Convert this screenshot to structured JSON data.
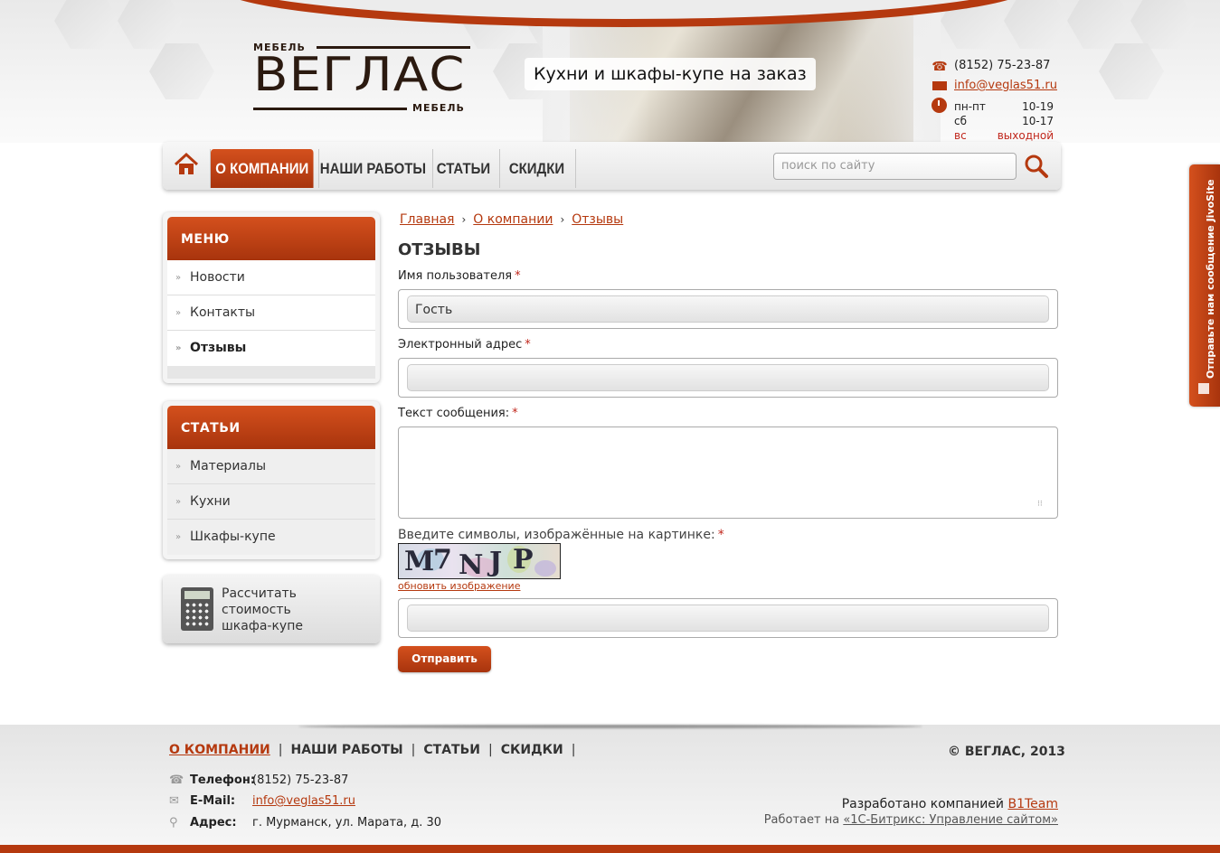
{
  "header": {
    "logo": {
      "top_word": "МЕБЕЛЬ",
      "brand": "ВЕГЛАС",
      "bottom_word": "МЕБЕЛЬ"
    },
    "slogan": "Кухни и шкафы-купе на заказ",
    "phone": "(8152) 75-23-87",
    "email": "info@veglas51.ru",
    "hours": [
      {
        "day": "пн-пт",
        "time": "10-19"
      },
      {
        "day": "сб",
        "time": "10-17"
      },
      {
        "day": "вс",
        "time": "выходной"
      }
    ]
  },
  "nav": {
    "items": [
      "О КОМПАНИИ",
      "НАШИ РАБОТЫ",
      "СТАТЬИ",
      "СКИДКИ"
    ],
    "active": "О КОМПАНИИ",
    "search_placeholder": "поиск по сайту"
  },
  "sidebar": {
    "menu_title": "МЕНЮ",
    "menu_items": [
      "Новости",
      "Контакты",
      "Отзывы"
    ],
    "articles_title": "СТАТЬИ",
    "article_items": [
      "Материалы",
      "Кухни",
      "Шкафы-купе"
    ],
    "calc_line1": "Рассчитать",
    "calc_line2": "стоимость",
    "calc_line3": "шкафа-купе"
  },
  "breadcrumbs": [
    "Главная",
    "О компании",
    "Отзывы"
  ],
  "form": {
    "title": "ОТЗЫВЫ",
    "name_label": "Имя пользователя",
    "name_value": "Гость",
    "email_label": "Электронный адрес",
    "email_value": "",
    "message_label": "Текст сообщения:",
    "message_value": "",
    "captcha_label": "Введите символы, изображённые на картинке:",
    "captcha_chars": [
      "M",
      "7",
      "N",
      "J",
      "P"
    ],
    "captcha_refresh": "обновить изображение",
    "captcha_value": "",
    "required_mark": "*",
    "submit_label": "Отправить"
  },
  "feedback_tab": "Отправьте нам сообщение JivoSite",
  "footer": {
    "nav": [
      "О КОМПАНИИ",
      "НАШИ РАБОТЫ",
      "СТАТЬИ",
      "СКИДКИ"
    ],
    "copyright": "© ВЕГЛАС, 2013",
    "phone_label": "Телефон:",
    "phone": "(8152) 75-23-87",
    "email_label": "E-Mail:",
    "email": "info@veglas51.ru",
    "address_label": "Адрес:",
    "address": "г. Мурманск, ул. Марата, д. 30",
    "developed_prefix": "Разработано компанией",
    "developer": "B1Team",
    "powered_prefix": "Работает на",
    "powered_by": "«1С-Битрикс: Управление сайтом»"
  },
  "colors": {
    "accent": "#b5390f",
    "accent_light": "#d4501d",
    "required": "#c0261b"
  }
}
